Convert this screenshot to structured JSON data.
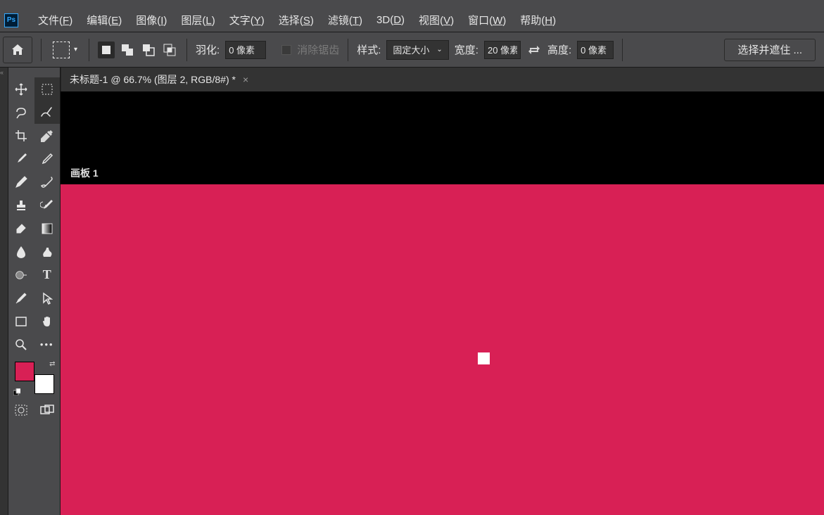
{
  "menubar": {
    "items": [
      {
        "label": "文件",
        "accel": "F"
      },
      {
        "label": "编辑",
        "accel": "E"
      },
      {
        "label": "图像",
        "accel": "I"
      },
      {
        "label": "图层",
        "accel": "L"
      },
      {
        "label": "文字",
        "accel": "Y"
      },
      {
        "label": "选择",
        "accel": "S"
      },
      {
        "label": "滤镜",
        "accel": "T"
      },
      {
        "label": "3D",
        "accel": "D"
      },
      {
        "label": "视图",
        "accel": "V"
      },
      {
        "label": "窗口",
        "accel": "W"
      },
      {
        "label": "帮助",
        "accel": "H"
      }
    ]
  },
  "optionsbar": {
    "feather_label": "羽化:",
    "feather_value": "0 像素",
    "antialias_label": "消除锯齿",
    "style_label": "样式:",
    "style_value": "固定大小",
    "width_label": "宽度:",
    "width_value": "20 像素",
    "height_label": "高度:",
    "height_value": "0 像素",
    "select_mask_label": "选择并遮住 ..."
  },
  "document": {
    "tab_title": "未标题-1 @ 66.7% (图层 2, RGB/8#) *",
    "artboard_label": "画板 1"
  },
  "colors": {
    "foreground": "#d82055",
    "background": "#ffffff",
    "canvas": "#d82055"
  },
  "tools": {
    "rows": [
      [
        "move-tool",
        "marquee-tool"
      ],
      [
        "lasso-tool",
        "quick-select-tool"
      ],
      [
        "crop-tool",
        "eyedropper-tool"
      ],
      [
        "brush-tool",
        "pencil-tool"
      ],
      [
        "mixer-brush-tool",
        "clone-stamp-tool"
      ],
      [
        "stamp-tool",
        "history-brush-tool"
      ],
      [
        "eraser-tool",
        "gradient-tool"
      ],
      [
        "blur-tool",
        "smudge-tool"
      ],
      [
        "sponge-tool",
        "type-tool"
      ],
      [
        "pen-tool",
        "path-select-tool"
      ],
      [
        "rectangle-tool",
        "hand-tool"
      ],
      [
        "zoom-tool",
        "more-tool"
      ]
    ],
    "active": "marquee-tool",
    "footer": [
      "quick-mask-tool",
      "screen-mode-tool"
    ]
  }
}
